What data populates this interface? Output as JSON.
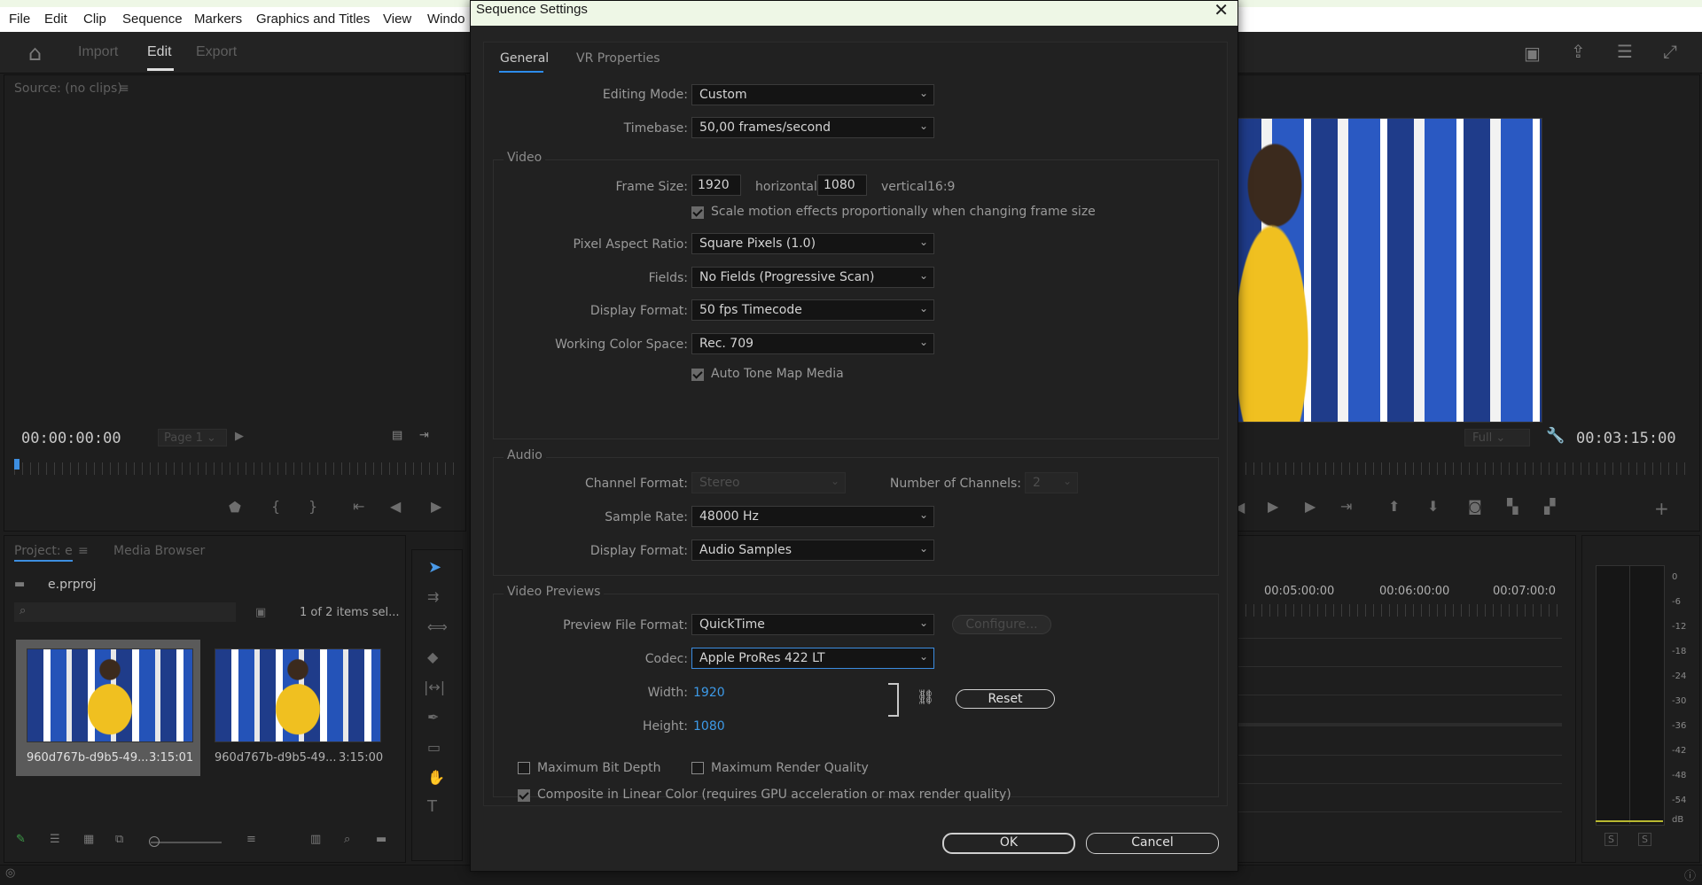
{
  "menu": [
    "File",
    "Edit",
    "Clip",
    "Sequence",
    "Markers",
    "Graphics and Titles",
    "View",
    "Windo"
  ],
  "workspace_tabs": {
    "import": "Import",
    "edit": "Edit",
    "export": "Export"
  },
  "source_panel": {
    "title": "Source: (no clips)",
    "timecode": "00:00:00:00",
    "page": "Page 1"
  },
  "program_panel": {
    "zoom": "Full",
    "timecode": "00:03:15:00"
  },
  "project_panel": {
    "tab_project": "Project: e",
    "tab_media_browser": "Media Browser",
    "project_file": "e.prproj",
    "selection_count": "1 of 2 items sel...",
    "clips": [
      {
        "name": "960d767b-d9b5-49...",
        "duration": "3:15:01"
      },
      {
        "name": "960d767b-d9b5-49...",
        "duration": "3:15:00"
      }
    ]
  },
  "timeline": {
    "ticks": [
      "00:05:00:00",
      "00:06:00:00",
      "00:07:00:0"
    ]
  },
  "meter": {
    "labels": [
      "0",
      "-6",
      "-12",
      "-18",
      "-24",
      "-30",
      "-36",
      "-42",
      "-48",
      "-54",
      "dB"
    ],
    "solo": [
      "S",
      "S"
    ]
  },
  "dialog": {
    "title": "Sequence Settings",
    "tabs": {
      "general": "General",
      "vr": "VR Properties"
    },
    "editing_mode_label": "Editing Mode:",
    "editing_mode": "Custom",
    "timebase_label": "Timebase:",
    "timebase": "50,00  frames/second",
    "video_title": "Video",
    "frame_size_label": "Frame Size:",
    "frame_w": "1920",
    "horizontal": "horizontal",
    "frame_h": "1080",
    "vertical": "vertical",
    "aspect": "16:9",
    "scale_motion": "Scale motion effects proportionally when changing frame size",
    "par_label": "Pixel Aspect Ratio:",
    "par": "Square Pixels (1.0)",
    "fields_label": "Fields:",
    "fields": "No Fields (Progressive Scan)",
    "vid_display_label": "Display Format:",
    "vid_display": "50 fps Timecode",
    "color_space_label": "Working Color Space:",
    "color_space": "Rec. 709",
    "auto_tone": "Auto Tone Map Media",
    "audio_title": "Audio",
    "channel_format_label": "Channel Format:",
    "channel_format": "Stereo",
    "num_channels_label": "Number of Channels:",
    "num_channels": "2",
    "sample_rate_label": "Sample Rate:",
    "sample_rate": "48000 Hz",
    "aud_display_label": "Display Format:",
    "aud_display": "Audio Samples",
    "previews_title": "Video Previews",
    "preview_format_label": "Preview File Format:",
    "preview_format": "QuickTime",
    "configure": "Configure...",
    "codec_label": "Codec:",
    "codec": "Apple ProRes 422 LT",
    "width_label": "Width:",
    "width": "1920",
    "height_label": "Height:",
    "height": "1080",
    "reset": "Reset",
    "max_bit_depth": "Maximum Bit Depth",
    "max_render_quality": "Maximum Render Quality",
    "composite_linear": "Composite in Linear Color (requires GPU acceleration or max render quality)",
    "ok": "OK",
    "cancel": "Cancel"
  }
}
